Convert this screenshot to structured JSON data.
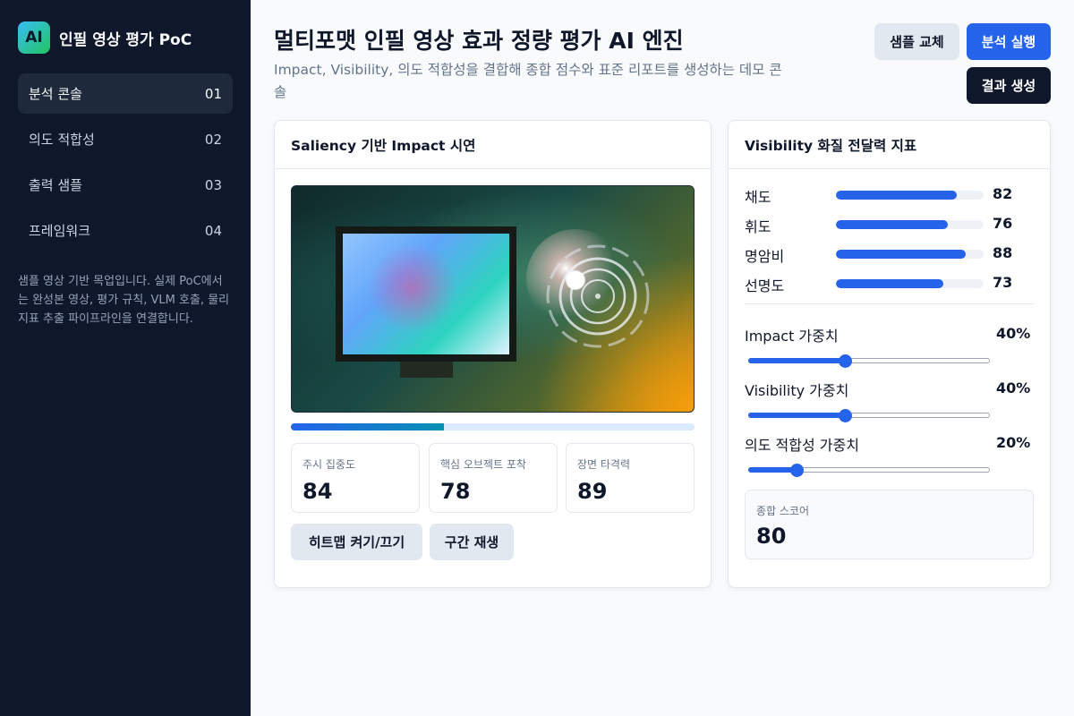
{
  "sidebar": {
    "logo_text": "AI",
    "title": "인필 영상 평가 PoC",
    "items": [
      {
        "label": "분석 콘솔",
        "num": "01"
      },
      {
        "label": "의도 적합성",
        "num": "02"
      },
      {
        "label": "출력 샘플",
        "num": "03"
      },
      {
        "label": "프레임워크",
        "num": "04"
      }
    ],
    "note": "샘플 영상 기반 목업입니다. 실제 PoC에서는 완성본 영상, 평가 규칙, VLM 호출, 물리 지표 추출 파이프라인을 연결합니다."
  },
  "header": {
    "title": "멀티포맷 인필 영상 효과 정량 평가 AI 엔진",
    "subtitle": "Impact, Visibility, 의도 적합성을 결합해 종합 점수와 표준 리포트를 생성하는 데모 콘솔",
    "btn_swap": "샘플 교체",
    "btn_run": "분석 실행",
    "btn_result": "결과 생성"
  },
  "impact": {
    "title": "Saliency 기반 Impact 시연",
    "progress": 0.38,
    "stats": [
      {
        "label": "주시 집중도",
        "value": "84"
      },
      {
        "label": "핵심 오브젝트 포착",
        "value": "78"
      },
      {
        "label": "장면 타격력",
        "value": "89"
      }
    ],
    "btn_heatmap": "히트맵 켜기/끄기",
    "btn_play": "구간 재생"
  },
  "visibility": {
    "title": "Visibility 화질 전달력 지표",
    "metrics": [
      {
        "label": "채도",
        "value": 82
      },
      {
        "label": "휘도",
        "value": 76
      },
      {
        "label": "명암비",
        "value": 88
      },
      {
        "label": "선명도",
        "value": 73
      }
    ],
    "weights": [
      {
        "label": "Impact 가중치",
        "display": "40%",
        "value": 0.4
      },
      {
        "label": "Visibility 가중치",
        "display": "40%",
        "value": 0.4
      },
      {
        "label": "의도 적합성 가중치",
        "display": "20%",
        "value": 0.2
      }
    ],
    "score_label": "종합 스코어",
    "score_value": "80"
  },
  "colors": {
    "accent": "#2563eb",
    "sidebar_bg": "#0f172a"
  }
}
